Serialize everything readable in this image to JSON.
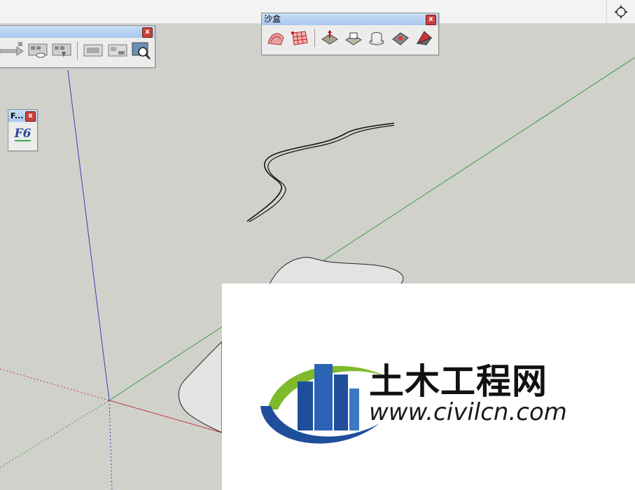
{
  "sandbox_toolbar": {
    "title": "沙盒",
    "close_label": "x",
    "tools": [
      {
        "name": "From Contours",
        "icon": "from-contours-icon"
      },
      {
        "name": "From Scratch",
        "icon": "from-scratch-icon"
      },
      {
        "name": "Smoove",
        "icon": "smoove-icon"
      },
      {
        "name": "Stamp",
        "icon": "stamp-icon"
      },
      {
        "name": "Drape",
        "icon": "drape-icon"
      },
      {
        "name": "Add Detail",
        "icon": "add-detail-icon"
      },
      {
        "name": "Flip Edge",
        "icon": "flip-edge-icon"
      }
    ]
  },
  "views_toolbar": {
    "close_label": "x"
  },
  "small_palette": {
    "title": "F...",
    "close_label": "x",
    "button_label": "F6"
  },
  "watermark": {
    "title": "土木工程网",
    "url": "www.civilcn.com"
  },
  "colors": {
    "axis_red": "#c43a3a",
    "axis_green": "#3a9a3a",
    "axis_blue": "#3a3ab8",
    "background": "#d0d1cb",
    "logo_blue": "#1f4f9a",
    "logo_green": "#7fba2b"
  }
}
